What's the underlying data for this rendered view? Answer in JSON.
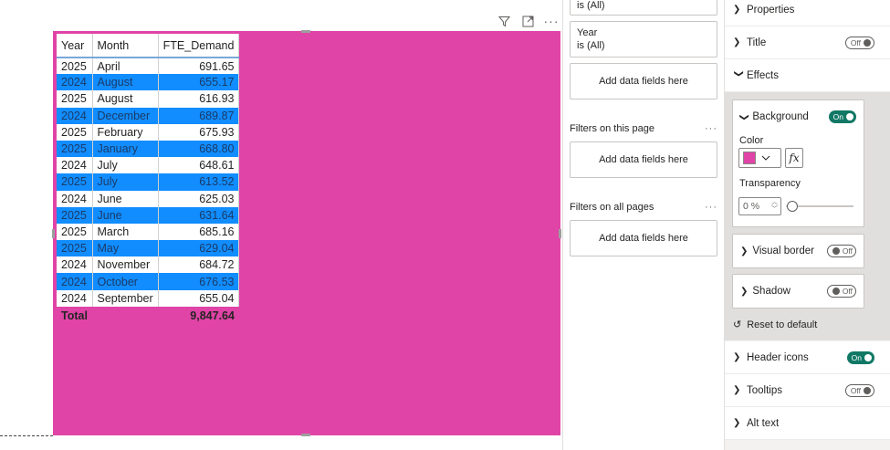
{
  "visual": {
    "background_color": "#e044a7",
    "header_icons": [
      "filter-icon",
      "focus-mode-icon",
      "more-options-icon"
    ],
    "table": {
      "columns": [
        "Year",
        "Month",
        "FTE_Demand"
      ],
      "rows": [
        [
          "2025",
          "April",
          "691.65"
        ],
        [
          "2024",
          "August",
          "655.17"
        ],
        [
          "2025",
          "August",
          "616.93"
        ],
        [
          "2024",
          "December",
          "689.87"
        ],
        [
          "2025",
          "February",
          "675.93"
        ],
        [
          "2025",
          "January",
          "668.80"
        ],
        [
          "2024",
          "July",
          "648.61"
        ],
        [
          "2025",
          "July",
          "613.52"
        ],
        [
          "2024",
          "June",
          "625.03"
        ],
        [
          "2025",
          "June",
          "631.64"
        ],
        [
          "2025",
          "March",
          "685.16"
        ],
        [
          "2025",
          "May",
          "629.04"
        ],
        [
          "2024",
          "November",
          "684.72"
        ],
        [
          "2024",
          "October",
          "676.53"
        ],
        [
          "2024",
          "September",
          "655.04"
        ]
      ],
      "total_label": "Total",
      "total_value": "9,847.64",
      "band_color": "#118dff"
    }
  },
  "filters": {
    "top_card_text": "is (All)",
    "year_card": {
      "field": "Year",
      "value": "is (All)"
    },
    "add_fields_label": "Add data fields here",
    "on_this_page": "Filters on this page",
    "on_all_pages": "Filters on all pages",
    "more": "···"
  },
  "format": {
    "properties": "Properties",
    "title": "Title",
    "title_toggle": "Off",
    "effects": "Effects",
    "background": {
      "label": "Background",
      "toggle": "On",
      "color_label": "Color",
      "fx": "fx",
      "transparency_label": "Transparency",
      "transparency_value": "0 %"
    },
    "visual_border": {
      "label": "Visual border",
      "toggle": "Off"
    },
    "shadow": {
      "label": "Shadow",
      "toggle": "Off"
    },
    "reset": "Reset to default",
    "header_icons": {
      "label": "Header icons",
      "toggle": "On"
    },
    "tooltips": {
      "label": "Tooltips",
      "toggle": "Off"
    },
    "alt_text": "Alt text",
    "accent_on": "#117865"
  }
}
